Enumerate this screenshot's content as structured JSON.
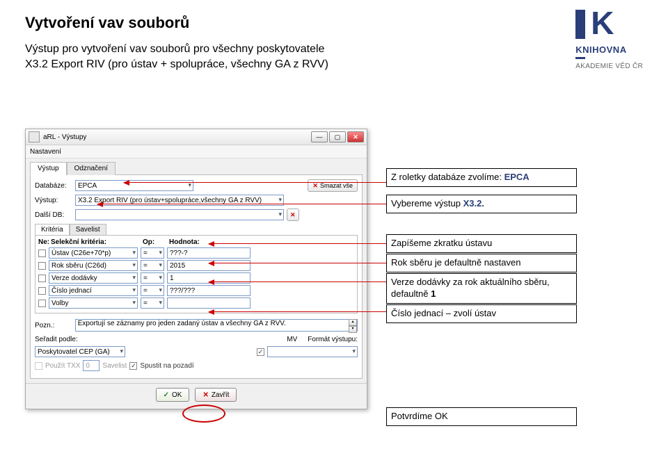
{
  "header": {
    "title": "Vytvoření vav souborů",
    "subtitle_line1": "Výstup pro vytvoření vav souborů pro všechny poskytovatele",
    "subtitle_line2": "X3.2 Export RIV (pro ústav + spolupráce, všechny GA z RVV)"
  },
  "logo": {
    "brand_short": "K",
    "brand": "KNIHOVNA",
    "subtitle": "AKADEMIE VĚD ČR"
  },
  "dialog": {
    "title": "aRL - Výstupy",
    "menu": "Nastavení",
    "tabs": {
      "vystup": "Výstup",
      "odznaceni": "Odznačení"
    },
    "fields": {
      "databaze_label": "Databáze:",
      "databaze_value": "EPCA",
      "smazat_vse": "Smazat vše",
      "vystup_label": "Výstup:",
      "vystup_value": "X3.2 Export RIV (pro ústav+spolupráce,všechny GA z RVV)",
      "dalsi_db_label": "Další DB:",
      "dalsi_db_value": ""
    },
    "subtabs": {
      "kriteria": "Kritéria",
      "savelist": "Savelist"
    },
    "criteria": {
      "header_ne": "Ne:",
      "header_sel": "Selekční kritéria:",
      "header_op": "Op:",
      "header_hodnota": "Hodnota:",
      "rows": [
        {
          "checked": false,
          "field": "Ústav (C26e+70*p)",
          "op": "=",
          "value": "???-?"
        },
        {
          "checked": false,
          "field": "Rok sběru (C26d)",
          "op": "=",
          "value": "2015"
        },
        {
          "checked": false,
          "field": "Verze dodávky",
          "op": "=",
          "value": "1"
        },
        {
          "checked": false,
          "field": "Číslo jednací",
          "op": "=",
          "value": "???/???"
        },
        {
          "checked": false,
          "field": "Volby",
          "op": "=",
          "value": ""
        }
      ]
    },
    "pozn_label": "Pozn.:",
    "pozn_value": "Exportují se záznamy pro jeden zadaný ústav a všechny GA z RVV.",
    "sort_label": "Seřadit podle:",
    "sort_value": "Poskytovatel CEP (GA)",
    "mv_label": "MV",
    "format_label": "Formát výstupu:",
    "format_value": "",
    "pouzit_txx": "Použít TXX",
    "savelist_num": "0",
    "savelist_label": "Savelist",
    "spustit_label": "Spustit na pozadí",
    "ok_label": "OK",
    "zavrit_label": "Zavřít"
  },
  "callouts": {
    "c1_line1": "Z roletky databáze zvolíme: ",
    "c1_strong": "EPCA",
    "c2_line1": "Vybereme výstup ",
    "c2_strong": "X3.2.",
    "c3": "Zapíšeme zkratku ústavu",
    "c4": "Rok sběru je defaultně nastaven",
    "c5_line1": "Verze dodávky za rok aktuálního sběru, defaultně ",
    "c5_strong": "1",
    "c6": "Číslo jednací – zvolí ústav",
    "c7": "Potvrdíme OK"
  }
}
